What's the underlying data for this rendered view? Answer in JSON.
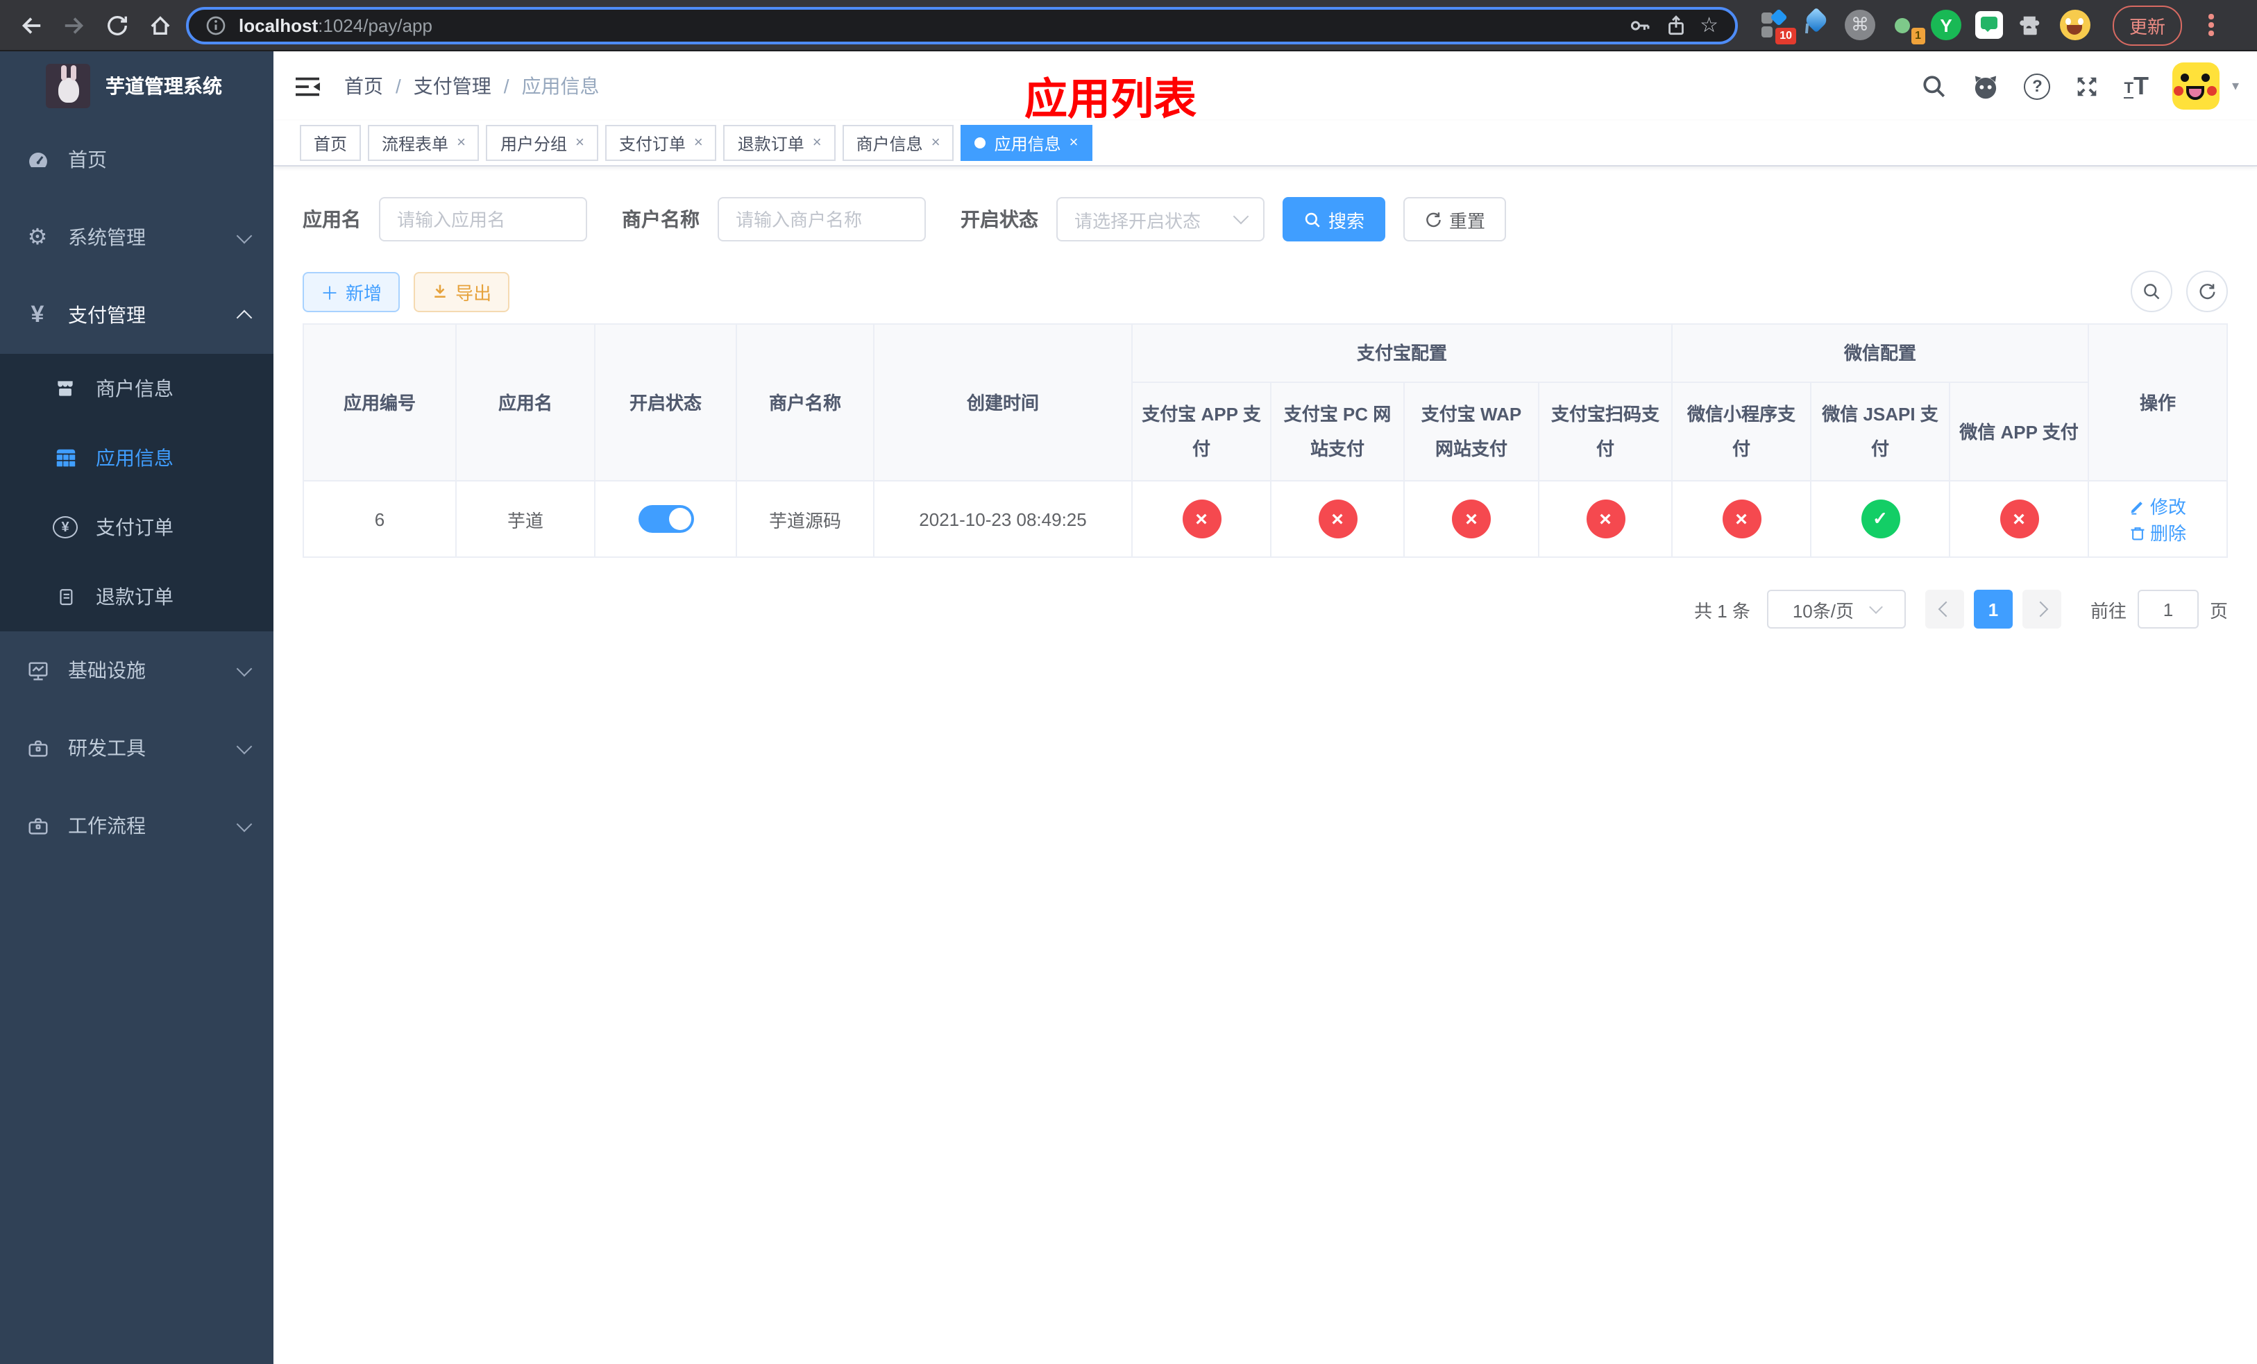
{
  "browser": {
    "url": {
      "host": "localhost",
      "path": ":1024/pay/app"
    },
    "update_label": "更新",
    "extension_badges": {
      "tampermonkey": "10",
      "switcher": "1"
    },
    "extension_letter": "Y"
  },
  "sidebar": {
    "logo_title": "芋道管理系统",
    "items": [
      {
        "label": "首页"
      },
      {
        "label": "系统管理"
      },
      {
        "label": "支付管理"
      },
      {
        "label": "基础设施"
      },
      {
        "label": "研发工具"
      },
      {
        "label": "工作流程"
      }
    ],
    "payment_submenu": [
      {
        "label": "商户信息"
      },
      {
        "label": "应用信息"
      },
      {
        "label": "支付订单"
      },
      {
        "label": "退款订单"
      }
    ]
  },
  "header": {
    "breadcrumb": [
      {
        "label": "首页"
      },
      {
        "label": "支付管理"
      },
      {
        "label": "应用信息"
      }
    ],
    "page_title_overlay": "应用列表"
  },
  "tabs": [
    {
      "label": "首页"
    },
    {
      "label": "流程表单"
    },
    {
      "label": "用户分组"
    },
    {
      "label": "支付订单"
    },
    {
      "label": "退款订单"
    },
    {
      "label": "商户信息"
    },
    {
      "label": "应用信息"
    }
  ],
  "filters": {
    "app_name_label": "应用名",
    "app_name_placeholder": "请输入应用名",
    "merchant_label": "商户名称",
    "merchant_placeholder": "请输入商户名称",
    "status_label": "开启状态",
    "status_placeholder": "请选择开启状态",
    "search_label": "搜索",
    "reset_label": "重置"
  },
  "toolbar": {
    "add_label": "新增",
    "export_label": "导出"
  },
  "table": {
    "group_headers": {
      "alipay": "支付宝配置",
      "wechat": "微信配置"
    },
    "headers": {
      "app_id": "应用编号",
      "app_name": "应用名",
      "status": "开启状态",
      "merchant_name": "商户名称",
      "create_time": "创建时间",
      "operation": "操作"
    },
    "sub_headers": [
      "支付宝 APP 支付",
      "支付宝 PC 网站支付",
      "支付宝 WAP 网站支付",
      "支付宝扫码支付",
      "微信小程序支付",
      "微信 JSAPI 支付",
      "微信 APP 支付"
    ],
    "rows": [
      {
        "app_id": "6",
        "app_name": "芋道",
        "enabled": "on",
        "merchant_name": "芋道源码",
        "create_time": "2021-10-23 08:49:25",
        "pay_channels": [
          "off",
          "off",
          "off",
          "off",
          "off",
          "on",
          "off"
        ],
        "edit_label": "修改",
        "delete_label": "删除"
      }
    ]
  },
  "pagination": {
    "total": "共 1 条",
    "page_size": "10条/页",
    "current_page": "1",
    "goto_label": "前往",
    "goto_value": "1",
    "page_unit": "页"
  },
  "colors": {
    "primary": "#409eff",
    "status_on": "#13ce66",
    "status_off": "#f5494f",
    "export_accent": "#e6a23c",
    "title_red": "#ff0000",
    "sidebar_bg": "#304156",
    "submenu_bg": "#1f2d3d"
  }
}
